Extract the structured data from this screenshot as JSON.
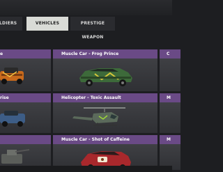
{
  "tabs": {
    "soldiers": "OLDIERS",
    "vehicles": "VEHICLES",
    "prestige": "PRESTIGE WEAPON"
  },
  "cards": {
    "r1_left": {
      "title": "e"
    },
    "r1_mid": {
      "title": "Muscle Car - Frog Prince"
    },
    "r1_right": {
      "title": "C"
    },
    "r2_left": {
      "title": "rise"
    },
    "r2_mid": {
      "title": "Helicopter - Toxic Assault"
    },
    "r2_right": {
      "title": "M"
    },
    "r3_mid": {
      "title": "Muscle Car - Shot of Caffeine"
    },
    "r3_right": {
      "title": "M"
    }
  },
  "colors": {
    "header_purple": "#6a4a86",
    "tab_active_bg": "#d9dbd6",
    "background": "#1d1e21"
  }
}
